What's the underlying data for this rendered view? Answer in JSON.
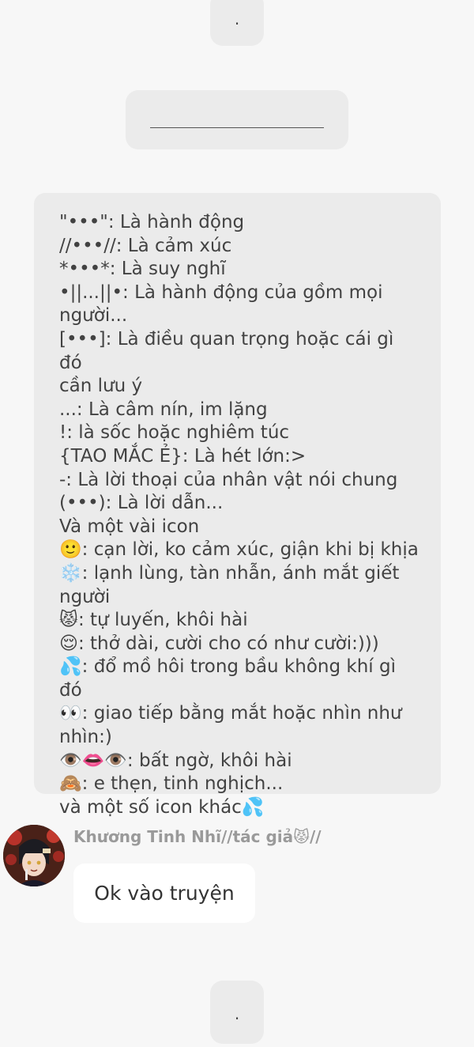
{
  "messages": {
    "top_dot": ".",
    "bottom_dot": "."
  },
  "legend": {
    "lines": [
      "\"•••\": Là hành động",
      "//•••//: Là cảm xúc",
      "*•••*: Là suy nghĩ",
      "•||...||•: Là hành động của gồm mọi",
      "người...",
      "[•••]: Là điều quan trọng hoặc cái gì đó",
      "cần lưu ý",
      "...: Là câm nín, im lặng",
      "!: là sốc hoặc nghiêm túc",
      "{TAO MẮC Ẻ}: Là hét lớn:>",
      "-: Là lời thoại của nhân vật nói chung",
      "(•••): Là lời dẫn...",
      "Và một vài icon",
      "🙂: cạn lời, ko cảm xúc, giận khi bị khịa",
      "❄️: lạnh lùng, tàn nhẫn, ánh mắt giết",
      "người",
      "😾: tự luyến, khôi hài",
      "😌: thở dài, cười cho có như cười:)))",
      "💦: đổ mồ hôi trong bầu không khí gì đó",
      "👀: giao tiếp bằng mắt hoặc nhìn như",
      "nhìn:)",
      "👁️👄👁️: bất ngờ, khôi hài",
      "🙈: e thẹn, tinh nghịch...",
      "và một số icon khác💦"
    ]
  },
  "author": {
    "name": "Khương Tinh Nhĩ//tác giả😾//",
    "avatar_icon": "anime-avatar-icon"
  },
  "reply": {
    "text": "Ok vào truyện"
  },
  "colors": {
    "background": "#f7f7f7",
    "bubble": "#ebebeb",
    "reply_bubble": "#ffffff",
    "author_name": "#9a9a9a"
  }
}
